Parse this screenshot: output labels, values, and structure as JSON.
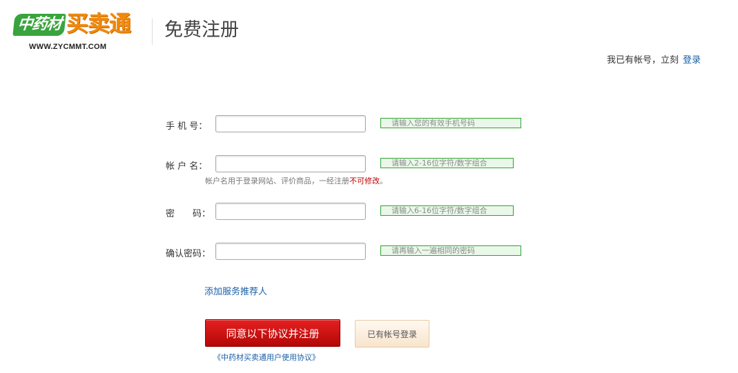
{
  "logo": {
    "brand_green": "中药材",
    "brand_orange": "买卖通",
    "url": "WWW.ZYCMMT.COM"
  },
  "header": {
    "title": "免费注册",
    "login_hint": "我已有帐号，立刻",
    "login_link": "登录"
  },
  "form": {
    "phone": {
      "label": "手 机 号：",
      "value": "",
      "tip": "请输入您的有效手机号码"
    },
    "username": {
      "label": "帐 户 名：",
      "value": "",
      "tip": "请输入2-16位字符/数字组合",
      "note_prefix": "帐户名用于登录网站、评价商品，一经注册",
      "note_warning": "不可修改",
      "note_suffix": "。"
    },
    "password": {
      "label": "密　　码：",
      "value": "",
      "tip": "请输入6-16位字符/数字组合"
    },
    "confirm_password": {
      "label": "确认密码：",
      "value": "",
      "tip": "请再输入一遍相同的密码"
    },
    "referrer_link": "添加服务推荐人"
  },
  "actions": {
    "agree_register": "同意以下协议并注册",
    "existing_login": "已有帐号登录",
    "agreement_link": "《中药材买卖通用户使用协议》"
  },
  "colors": {
    "link": "#1a5fa8",
    "primary_button": "#d01010",
    "tip_border": "#2da42d",
    "tip_background": "#eaf8ea",
    "warning": "#c00000",
    "logo_green": "#39a43d",
    "logo_orange": "#f08a0c"
  }
}
